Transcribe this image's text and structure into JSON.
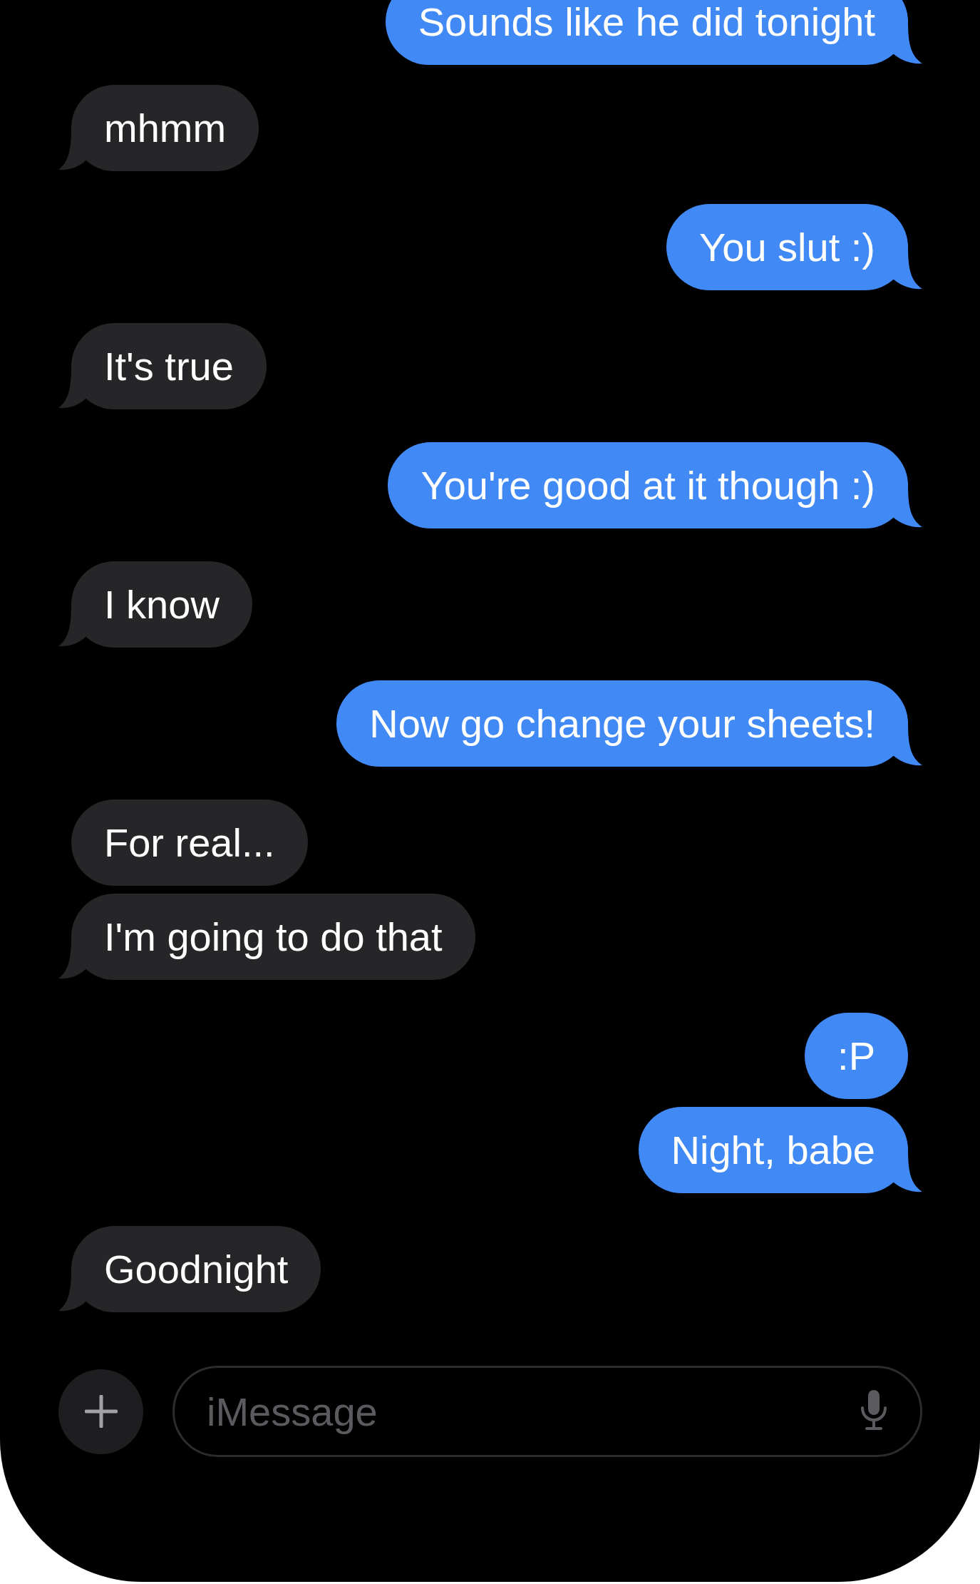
{
  "messages": [
    {
      "kind": "sent",
      "text": "Sounds like he did tonight",
      "tail": true
    },
    {
      "kind": "received",
      "text": "mhmm",
      "tail": true
    },
    {
      "kind": "sent",
      "text": "You slut :)",
      "tail": true
    },
    {
      "kind": "received",
      "text": "It's true",
      "tail": true
    },
    {
      "kind": "sent",
      "text": "You're good at it though :)",
      "tail": true
    },
    {
      "kind": "received",
      "text": "I know",
      "tail": true
    },
    {
      "kind": "sent",
      "text": "Now go change your sheets!",
      "tail": true
    },
    {
      "kind": "received",
      "text": "For real...",
      "tail": false
    },
    {
      "kind": "received",
      "text": "I'm going to do that",
      "tail": true
    },
    {
      "kind": "sent",
      "text": ":P",
      "tail": false
    },
    {
      "kind": "sent",
      "text": "Night, babe",
      "tail": true
    },
    {
      "kind": "received",
      "text": "Goodnight",
      "tail": true
    }
  ],
  "composer": {
    "placeholder": "iMessage"
  }
}
